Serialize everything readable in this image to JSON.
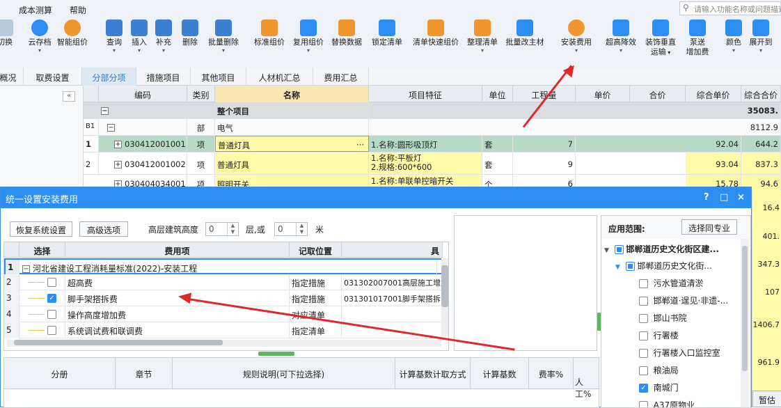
{
  "menu": {
    "items": [
      "成本测算",
      "帮助"
    ],
    "search_placeholder": "请输入功能名称或问题描述"
  },
  "toolbar": {
    "items": [
      "切换",
      "云存档",
      "智能组价",
      "查询",
      "插入",
      "补充",
      "删除",
      "批量删除",
      "标准组价",
      "复用组价",
      "替换数据",
      "锁定清单",
      "清单快速组价",
      "整理清单",
      "批量改主材",
      "安装费用",
      "超高降效",
      "装饰垂直运输",
      "泵送增加费",
      "颜色",
      "展开到"
    ],
    "split_labels": {
      "装饰垂直运输": [
        "装饰垂直",
        "运输"
      ],
      "泵送增加费": [
        "泵送",
        "增加费"
      ]
    }
  },
  "tabs": [
    "概况",
    "取费设置",
    "分部分项",
    "措施项目",
    "其他项目",
    "人材机汇总",
    "费用汇总"
  ],
  "collapse_label": "«",
  "grid": {
    "headers": [
      "编码",
      "类别",
      "名称",
      "项目特征",
      "单位",
      "工程量",
      "单价",
      "合价",
      "综合单价",
      "综合合价"
    ],
    "rows": [
      {
        "idx": "",
        "code": "",
        "type": "",
        "name": "整个项目",
        "feature": "",
        "unit": "",
        "qty": "",
        "price": "",
        "total": "",
        "uprice": "",
        "utotal": "35083."
      },
      {
        "idx": "B1",
        "code": "",
        "type": "部",
        "name": "电气",
        "feature": "",
        "unit": "",
        "qty": "",
        "price": "",
        "total": "",
        "uprice": "",
        "utotal": "8112.9"
      },
      {
        "idx": "1",
        "code": "030412001001",
        "type": "项",
        "name": "普通灯具",
        "feature": "1.名称:圆形吸顶灯",
        "unit": "套",
        "qty": "7",
        "price": "",
        "total": "",
        "uprice": "92.04",
        "utotal": "644.2"
      },
      {
        "idx": "2",
        "code": "030412001002",
        "type": "项",
        "name": "普通灯具",
        "feature": "1.名称:平板灯",
        "feature2": "2.规格:600*600",
        "unit": "套",
        "qty": "9",
        "price": "",
        "total": "",
        "uprice": "93.04",
        "utotal": "837.3"
      },
      {
        "idx": "3",
        "code": "030404034001",
        "type": "项",
        "name": "照明开关",
        "feature": "1.名称:单联单控暗开关",
        "unit": "个",
        "qty": "6",
        "price": "",
        "total": "",
        "uprice": "15.78",
        "utotal": "94.6"
      }
    ],
    "side_values": [
      "16.4",
      "401.",
      "347.3",
      "107",
      "1406.7",
      "961.9"
    ],
    "ellipsis": "···"
  },
  "dialog": {
    "title": "统一设置安装费用",
    "controls": [
      "?",
      "□",
      "×"
    ],
    "restore_btn": "恢复系统设置",
    "advanced_btn": "高级选项",
    "height_label": "高层建筑高度",
    "height_value": "0",
    "floor_label": "层,或",
    "floor_value": "0",
    "meter_label": "米",
    "fee_headers": [
      "选择",
      "费用项",
      "记取位置",
      "具"
    ],
    "fee_rows": [
      {
        "idx": "1",
        "name": "河北省建设工程消耗量标准(2022)-安装工程",
        "pos": "",
        "detail": "",
        "checked": false,
        "group": true
      },
      {
        "idx": "2",
        "name": "超高费",
        "pos": "指定措施",
        "detail": "031302007001高层施工增加",
        "checked": false
      },
      {
        "idx": "3",
        "name": "脚手架搭拆费",
        "pos": "指定措施",
        "detail": "031301017001脚手架搭拆",
        "checked": true
      },
      {
        "idx": "4",
        "name": "操作高度增加费",
        "pos": "对应清单",
        "detail": "",
        "checked": false
      },
      {
        "idx": "5",
        "name": "系统调试费和联调费",
        "pos": "指定清单",
        "detail": "",
        "checked": false
      }
    ],
    "bottom_headers": [
      "分册",
      "章节",
      "规则说明(可下拉选择)",
      "计算基数计取方式",
      "计算基数",
      "费率%",
      "人工%"
    ],
    "scope_label": "应用范围:",
    "same_major_btn": "选择同专业",
    "scope_tree": [
      {
        "label": "邯郸道历史文化街区建...",
        "level": 0,
        "state": "partial"
      },
      {
        "label": "邯郸道历史文化街...",
        "level": 1,
        "state": "partial"
      },
      {
        "label": "污水管道清淤",
        "level": 2,
        "state": "off"
      },
      {
        "label": "邯郸道·逞见·非遗-...",
        "level": 2,
        "state": "off"
      },
      {
        "label": "邯山书院",
        "level": 2,
        "state": "off"
      },
      {
        "label": "行署楼",
        "level": 2,
        "state": "off"
      },
      {
        "label": "行署楼入口监控室",
        "level": 2,
        "state": "off"
      },
      {
        "label": "粮油局",
        "level": 2,
        "state": "off"
      },
      {
        "label": "南城门",
        "level": 2,
        "state": "on"
      },
      {
        "label": "A37原物业",
        "level": 2,
        "state": "off"
      }
    ],
    "temp_btn": "暂估"
  },
  "colors": {
    "accent": "#2c8ef3",
    "annotation": "#e0282a",
    "selected_row": "#b6d9c8",
    "highlight": "#fffaa8"
  }
}
